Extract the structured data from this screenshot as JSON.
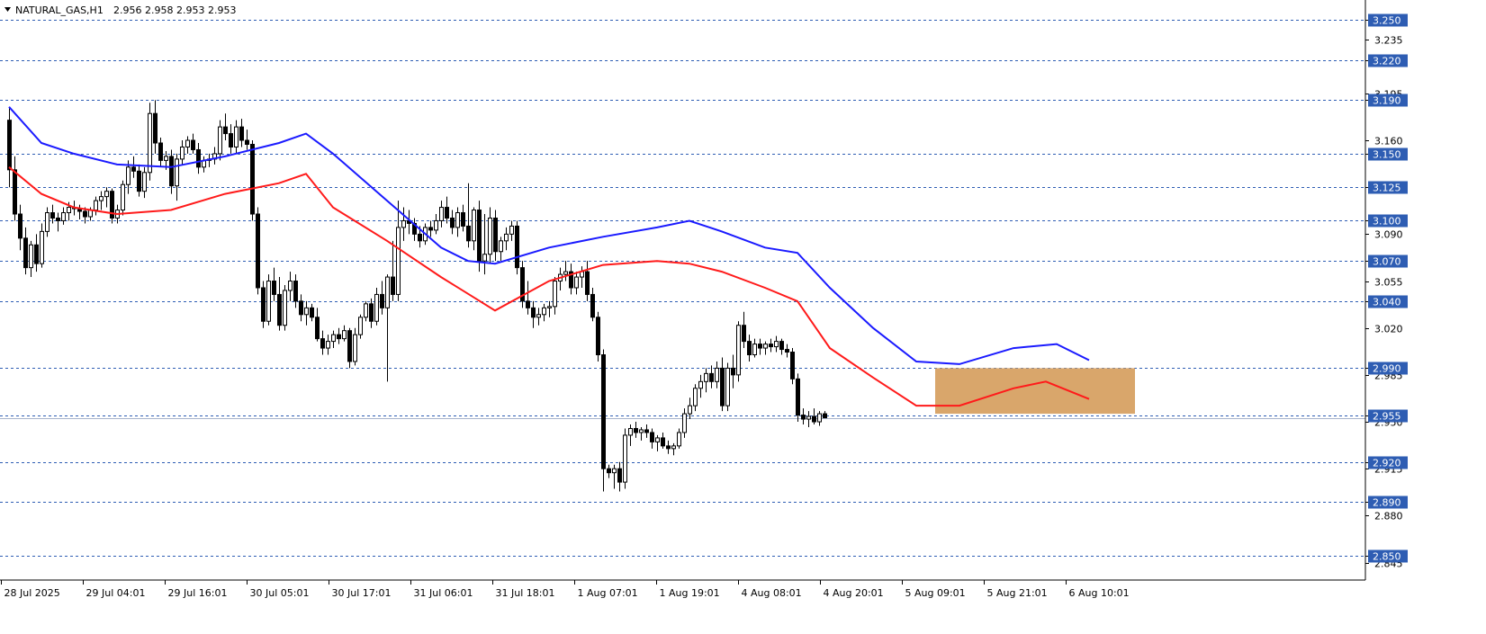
{
  "header": {
    "symbol": "NATURAL_GAS,H1",
    "ohlc": "2.956 2.958 2.953 2.953"
  },
  "colors": {
    "background": "#ffffff",
    "axis": "#000000",
    "grid": "#2e5db3",
    "level_label_bg": "#2e5db3",
    "candle_bull": "#000000",
    "candle_bear": "#000000",
    "candle_bull_fill": "#ffffff",
    "ma_fast": "#1a1aff",
    "ma_slow": "#ff1a1a",
    "zone_fill": "#d9a66b",
    "current_price_line": "#a8b4cc"
  },
  "chart_data": {
    "type": "candlestick",
    "timeframe": "H1",
    "ylim": [
      2.842,
      3.262
    ],
    "y_ticks": [
      "3.235",
      "3.195",
      "3.160",
      "3.090",
      "3.055",
      "3.020",
      "2.985",
      "2.950",
      "2.915",
      "2.880",
      "2.845"
    ],
    "x_ticks": [
      "28 Jul 2025",
      "29 Jul 04:01",
      "29 Jul 16:01",
      "30 Jul 05:01",
      "30 Jul 17:01",
      "31 Jul 06:01",
      "31 Jul 18:01",
      "1 Aug 07:01",
      "1 Aug 19:01",
      "4 Aug 08:01",
      "4 Aug 20:01",
      "5 Aug 09:01",
      "5 Aug 21:01",
      "6 Aug 10:01"
    ],
    "levels": [
      "3.250",
      "3.220",
      "3.190",
      "3.150",
      "3.125",
      "3.100",
      "3.070",
      "3.040",
      "2.990",
      "2.955",
      "2.920",
      "2.890",
      "2.850"
    ],
    "current_price": 2.953,
    "zone": {
      "from_bar": 172,
      "to_bar": 208,
      "high": 2.99,
      "low": 2.956
    },
    "ma_fast": [
      [
        0,
        3.185
      ],
      [
        6,
        3.158
      ],
      [
        12,
        3.15
      ],
      [
        20,
        3.142
      ],
      [
        30,
        3.14
      ],
      [
        40,
        3.148
      ],
      [
        50,
        3.158
      ],
      [
        55,
        3.165
      ],
      [
        60,
        3.15
      ],
      [
        70,
        3.115
      ],
      [
        80,
        3.08
      ],
      [
        85,
        3.07
      ],
      [
        90,
        3.068
      ],
      [
        100,
        3.08
      ],
      [
        110,
        3.088
      ],
      [
        120,
        3.095
      ],
      [
        126,
        3.1
      ],
      [
        132,
        3.092
      ],
      [
        140,
        3.08
      ],
      [
        146,
        3.076
      ],
      [
        152,
        3.05
      ],
      [
        160,
        3.02
      ],
      [
        168,
        2.995
      ],
      [
        176,
        2.993
      ],
      [
        186,
        3.005
      ],
      [
        194,
        3.008
      ],
      [
        200,
        2.996
      ]
    ],
    "ma_slow": [
      [
        0,
        3.14
      ],
      [
        6,
        3.12
      ],
      [
        12,
        3.11
      ],
      [
        20,
        3.105
      ],
      [
        30,
        3.108
      ],
      [
        40,
        3.12
      ],
      [
        50,
        3.128
      ],
      [
        55,
        3.135
      ],
      [
        60,
        3.11
      ],
      [
        70,
        3.085
      ],
      [
        80,
        3.058
      ],
      [
        90,
        3.033
      ],
      [
        100,
        3.055
      ],
      [
        110,
        3.067
      ],
      [
        120,
        3.07
      ],
      [
        126,
        3.068
      ],
      [
        132,
        3.062
      ],
      [
        140,
        3.05
      ],
      [
        146,
        3.04
      ],
      [
        152,
        3.005
      ],
      [
        160,
        2.983
      ],
      [
        168,
        2.962
      ],
      [
        176,
        2.962
      ],
      [
        186,
        2.975
      ],
      [
        192,
        2.98
      ],
      [
        200,
        2.967
      ]
    ],
    "candles": [
      [
        3.175,
        3.184,
        3.125,
        3.138
      ],
      [
        3.138,
        3.148,
        3.1,
        3.105
      ],
      [
        3.105,
        3.112,
        3.078,
        3.087
      ],
      [
        3.087,
        3.095,
        3.06,
        3.065
      ],
      [
        3.065,
        3.085,
        3.058,
        3.082
      ],
      [
        3.082,
        3.09,
        3.062,
        3.068
      ],
      [
        3.068,
        3.098,
        3.065,
        3.092
      ],
      [
        3.092,
        3.11,
        3.088,
        3.106
      ],
      [
        3.106,
        3.112,
        3.098,
        3.102
      ],
      [
        3.102,
        3.106,
        3.092,
        3.1
      ],
      [
        3.1,
        3.11,
        3.097,
        3.106
      ],
      [
        3.106,
        3.114,
        3.1,
        3.11
      ],
      [
        3.11,
        3.115,
        3.104,
        3.109
      ],
      [
        3.109,
        3.112,
        3.101,
        3.107
      ],
      [
        3.107,
        3.11,
        3.098,
        3.103
      ],
      [
        3.103,
        3.11,
        3.1,
        3.108
      ],
      [
        3.108,
        3.118,
        3.104,
        3.115
      ],
      [
        3.115,
        3.122,
        3.108,
        3.118
      ],
      [
        3.118,
        3.125,
        3.11,
        3.122
      ],
      [
        3.122,
        3.124,
        3.098,
        3.102
      ],
      [
        3.102,
        3.112,
        3.098,
        3.108
      ],
      [
        3.108,
        3.13,
        3.104,
        3.127
      ],
      [
        3.127,
        3.145,
        3.12,
        3.14
      ],
      [
        3.14,
        3.148,
        3.132,
        3.137
      ],
      [
        3.137,
        3.142,
        3.118,
        3.122
      ],
      [
        3.122,
        3.14,
        3.117,
        3.136
      ],
      [
        3.136,
        3.188,
        3.13,
        3.18
      ],
      [
        3.18,
        3.19,
        3.15,
        3.158
      ],
      [
        3.158,
        3.162,
        3.14,
        3.145
      ],
      [
        3.145,
        3.152,
        3.138,
        3.148
      ],
      [
        3.148,
        3.153,
        3.12,
        3.126
      ],
      [
        3.126,
        3.15,
        3.115,
        3.146
      ],
      [
        3.146,
        3.16,
        3.142,
        3.155
      ],
      [
        3.155,
        3.163,
        3.15,
        3.16
      ],
      [
        3.16,
        3.165,
        3.15,
        3.153
      ],
      [
        3.153,
        3.158,
        3.135,
        3.14
      ],
      [
        3.14,
        3.148,
        3.136,
        3.145
      ],
      [
        3.145,
        3.15,
        3.14,
        3.146
      ],
      [
        3.146,
        3.155,
        3.142,
        3.15
      ],
      [
        3.15,
        3.175,
        3.145,
        3.17
      ],
      [
        3.17,
        3.18,
        3.16,
        3.165
      ],
      [
        3.165,
        3.172,
        3.15,
        3.155
      ],
      [
        3.155,
        3.175,
        3.15,
        3.17
      ],
      [
        3.17,
        3.176,
        3.155,
        3.16
      ],
      [
        3.16,
        3.168,
        3.153,
        3.157
      ],
      [
        3.157,
        3.16,
        3.1,
        3.105
      ],
      [
        3.105,
        3.11,
        3.045,
        3.05
      ],
      [
        3.05,
        3.055,
        3.02,
        3.025
      ],
      [
        3.025,
        3.06,
        3.022,
        3.055
      ],
      [
        3.055,
        3.065,
        3.04,
        3.045
      ],
      [
        3.045,
        3.058,
        3.018,
        3.022
      ],
      [
        3.022,
        3.052,
        3.018,
        3.048
      ],
      [
        3.048,
        3.062,
        3.04,
        3.055
      ],
      [
        3.055,
        3.06,
        3.035,
        3.04
      ],
      [
        3.04,
        3.045,
        3.025,
        3.03
      ],
      [
        3.03,
        3.04,
        3.022,
        3.035
      ],
      [
        3.035,
        3.038,
        3.025,
        3.028
      ],
      [
        3.028,
        3.035,
        3.01,
        3.012
      ],
      [
        3.012,
        3.018,
        3.0,
        3.005
      ],
      [
        3.005,
        3.015,
        3.0,
        3.01
      ],
      [
        3.01,
        3.018,
        3.005,
        3.015
      ],
      [
        3.015,
        3.02,
        3.008,
        3.012
      ],
      [
        3.012,
        3.022,
        3.01,
        3.018
      ],
      [
        3.018,
        3.02,
        2.99,
        2.995
      ],
      [
        2.995,
        3.02,
        2.992,
        3.015
      ],
      [
        3.015,
        3.03,
        3.012,
        3.028
      ],
      [
        3.028,
        3.04,
        3.025,
        3.038
      ],
      [
        3.038,
        3.042,
        3.02,
        3.025
      ],
      [
        3.025,
        3.05,
        3.022,
        3.045
      ],
      [
        3.045,
        3.055,
        3.03,
        3.035
      ],
      [
        3.035,
        3.06,
        2.98,
        3.058
      ],
      [
        3.058,
        3.085,
        3.04,
        3.045
      ],
      [
        3.045,
        3.115,
        3.04,
        3.095
      ],
      [
        3.095,
        3.11,
        3.085,
        3.1
      ],
      [
        3.1,
        3.108,
        3.09,
        3.098
      ],
      [
        3.098,
        3.102,
        3.085,
        3.09
      ],
      [
        3.09,
        3.096,
        3.08,
        3.085
      ],
      [
        3.085,
        3.098,
        3.082,
        3.095
      ],
      [
        3.095,
        3.1,
        3.088,
        3.093
      ],
      [
        3.093,
        3.105,
        3.09,
        3.1
      ],
      [
        3.1,
        3.115,
        3.095,
        3.11
      ],
      [
        3.11,
        3.118,
        3.098,
        3.102
      ],
      [
        3.102,
        3.108,
        3.09,
        3.095
      ],
      [
        3.095,
        3.11,
        3.088,
        3.106
      ],
      [
        3.106,
        3.112,
        3.092,
        3.096
      ],
      [
        3.096,
        3.128,
        3.08,
        3.085
      ],
      [
        3.085,
        3.11,
        3.078,
        3.108
      ],
      [
        3.108,
        3.115,
        3.062,
        3.07
      ],
      [
        3.07,
        3.105,
        3.06,
        3.075
      ],
      [
        3.075,
        3.11,
        3.068,
        3.102
      ],
      [
        3.102,
        3.108,
        3.07,
        3.077
      ],
      [
        3.077,
        3.088,
        3.07,
        3.085
      ],
      [
        3.085,
        3.095,
        3.078,
        3.09
      ],
      [
        3.09,
        3.1,
        3.085,
        3.096
      ],
      [
        3.096,
        3.1,
        3.06,
        3.065
      ],
      [
        3.065,
        3.07,
        3.035,
        3.04
      ],
      [
        3.04,
        3.055,
        3.03,
        3.035
      ],
      [
        3.035,
        3.04,
        3.02,
        3.028
      ],
      [
        3.028,
        3.035,
        3.022,
        3.03
      ],
      [
        3.03,
        3.038,
        3.025,
        3.035
      ],
      [
        3.035,
        3.04,
        3.028,
        3.036
      ],
      [
        3.036,
        3.058,
        3.03,
        3.055
      ],
      [
        3.055,
        3.065,
        3.048,
        3.06
      ],
      [
        3.06,
        3.07,
        3.055,
        3.062
      ],
      [
        3.062,
        3.068,
        3.045,
        3.05
      ],
      [
        3.05,
        3.062,
        3.045,
        3.058
      ],
      [
        3.058,
        3.066,
        3.05,
        3.062
      ],
      [
        3.062,
        3.07,
        3.04,
        3.045
      ],
      [
        3.045,
        3.05,
        3.025,
        3.028
      ],
      [
        3.028,
        3.032,
        2.995,
        3.0
      ],
      [
        3.0,
        3.004,
        2.898,
        2.915
      ],
      [
        2.915,
        2.918,
        2.908,
        2.912
      ],
      [
        2.912,
        2.918,
        2.9,
        2.915
      ],
      [
        2.915,
        2.92,
        2.898,
        2.905
      ],
      [
        2.905,
        2.945,
        2.9,
        2.94
      ],
      [
        2.94,
        2.948,
        2.932,
        2.945
      ],
      [
        2.945,
        2.95,
        2.938,
        2.942
      ],
      [
        2.942,
        2.946,
        2.936,
        2.944
      ],
      [
        2.944,
        2.948,
        2.938,
        2.942
      ],
      [
        2.942,
        2.945,
        2.93,
        2.935
      ],
      [
        2.935,
        2.94,
        2.928,
        2.938
      ],
      [
        2.938,
        2.942,
        2.93,
        2.932
      ],
      [
        2.932,
        2.936,
        2.926,
        2.93
      ],
      [
        2.93,
        2.934,
        2.925,
        2.932
      ],
      [
        2.932,
        2.945,
        2.93,
        2.942
      ],
      [
        2.942,
        2.96,
        2.938,
        2.956
      ],
      [
        2.956,
        2.968,
        2.952,
        2.962
      ],
      [
        2.962,
        2.978,
        2.958,
        2.975
      ],
      [
        2.975,
        2.985,
        2.968,
        2.98
      ],
      [
        2.98,
        2.99,
        2.972,
        2.986
      ],
      [
        2.986,
        2.992,
        2.975,
        2.98
      ],
      [
        2.98,
        2.995,
        2.975,
        2.99
      ],
      [
        2.99,
        2.998,
        2.958,
        2.962
      ],
      [
        2.962,
        2.994,
        2.958,
        2.99
      ],
      [
        2.99,
        3.0,
        2.975,
        2.985
      ],
      [
        2.985,
        3.025,
        2.98,
        3.022
      ],
      [
        3.022,
        3.032,
        3.005,
        3.01
      ],
      [
        3.01,
        3.015,
        2.995,
        3.0
      ],
      [
        3.0,
        3.012,
        2.998,
        3.008
      ],
      [
        3.008,
        3.012,
        3.0,
        3.005
      ],
      [
        3.005,
        3.01,
        3.0,
        3.008
      ],
      [
        3.008,
        3.012,
        3.002,
        3.006
      ],
      [
        3.006,
        3.014,
        3.002,
        3.01
      ],
      [
        3.01,
        3.012,
        3.0,
        3.004
      ],
      [
        3.004,
        3.008,
        2.998,
        3.002
      ],
      [
        3.002,
        3.005,
        2.978,
        2.982
      ],
      [
        2.982,
        2.986,
        2.95,
        2.955
      ],
      [
        2.955,
        2.96,
        2.948,
        2.952
      ],
      [
        2.952,
        2.958,
        2.946,
        2.954
      ],
      [
        2.954,
        2.96,
        2.948,
        2.95
      ],
      [
        2.95,
        2.958,
        2.947,
        2.956
      ],
      [
        2.956,
        2.958,
        2.953,
        2.953
      ]
    ]
  }
}
